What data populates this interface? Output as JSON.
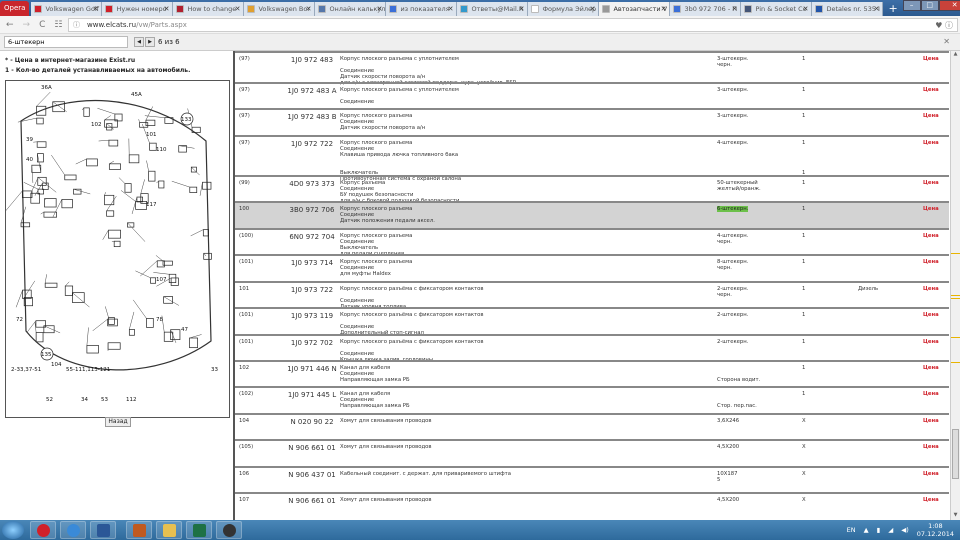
{
  "browser": {
    "name": "Opera",
    "tabs": [
      {
        "label": "Volkswagen Golf",
        "color": "#d0202a"
      },
      {
        "label": "Нужен номеро",
        "color": "#d0202a"
      },
      {
        "label": "How to change",
        "color": "#b02030"
      },
      {
        "label": "Volkswagen Bor",
        "color": "#e0a030"
      },
      {
        "label": "Онлайн калькул",
        "color": "#5577aa"
      },
      {
        "label": "из показателя",
        "color": "#3b6fd8"
      },
      {
        "label": "Ответы@Mail.R",
        "color": "#3399cc"
      },
      {
        "label": "Формула Эйлер",
        "color": "#ffffff"
      },
      {
        "label": "Автозапчасти V",
        "color": "#999999",
        "active": true
      },
      {
        "label": "3b0 972 706 - П",
        "color": "#3b6fd8"
      },
      {
        "label": "Pin & Socket Co",
        "color": "#445577"
      },
      {
        "label": "Detales nr. 535 I",
        "color": "#2255aa"
      }
    ],
    "url_domain": "www.elcats.ru",
    "url_path": "/vw/Parts.aspx"
  },
  "find": {
    "query": "6-штекерн",
    "count": "6 из 6"
  },
  "left": {
    "note1": "* - Цена в интернет-магазине Exist.ru",
    "note2": "1 - Кол-во деталей устанавливаемых на автомобиль.",
    "back": "Назад"
  },
  "rows": [
    {
      "ref": "(97)",
      "pn": "1J0 972 483",
      "desc": [
        "Корпус плоского разъема с уплотнителем",
        "",
        "Соединение",
        "Датчик скорости поворота а/н",
        "для а/н с электронной системой поддерж. курс. устойчив. ESP"
      ],
      "spec": [
        "3-штекерн.",
        "черн."
      ],
      "qty": [
        "1"
      ],
      "price": "Цена"
    },
    {
      "ref": "(97)",
      "pn": "1J0 972 483 A",
      "desc": [
        "Корпус плоского разъема с уплотнителем",
        "",
        "Соединение"
      ],
      "spec": [
        "3-штекерн."
      ],
      "qty": [
        "1"
      ],
      "price": "Цена"
    },
    {
      "ref": "(97)",
      "pn": "1J0 972 483 B",
      "desc": [
        "Корпус плоского разъема",
        "Соединение",
        "Датчик скорости поворота а/н"
      ],
      "spec": [
        "3-штекерн."
      ],
      "qty": [
        "1"
      ],
      "price": "Цена"
    },
    {
      "ref": "(97)",
      "pn": "1J0 972 722",
      "desc": [
        "Корпус плоского разъема",
        "Соединение",
        "Клавиша привода лючка топливного бака",
        "",
        "",
        "Выключатель",
        "Противоугонная система с охраной салона"
      ],
      "spec": [
        "4-штекерн."
      ],
      "qty": [
        "1",
        "",
        "",
        "",
        "",
        "1"
      ],
      "price": "Цена"
    },
    {
      "ref": "(99)",
      "pn": "4D0 973 373",
      "desc": [
        "Корпус разъема",
        "Соединение",
        "БУ подушек безопасности",
        "для а/н с боковой подушкой безопасности"
      ],
      "spec": [
        "50-штекерный",
        "желтый/оранж."
      ],
      "qty": [
        "1"
      ],
      "price": "Цена"
    },
    {
      "ref": "100",
      "pn": "3B0 972 706",
      "desc": [
        "Корпус плоского разъема",
        "Соединение",
        "Датчик положения педали аксел."
      ],
      "spec": [
        "6-штекерн."
      ],
      "qty": [
        "1"
      ],
      "price": "Цена",
      "highlight": true
    },
    {
      "ref": "(100)",
      "pn": "6N0 972 704",
      "desc": [
        "Корпус плоского разъема",
        "Соединение",
        "Выключатель",
        "для педали сцепления"
      ],
      "spec": [
        "4-штекерн.",
        "черн."
      ],
      "qty": [
        "1"
      ],
      "price": "Цена"
    },
    {
      "ref": "(101)",
      "pn": "1J0 973 714",
      "desc": [
        "Корпус плоского разъема",
        "Соединение",
        "для муфты Haldex"
      ],
      "spec": [
        "8-штекерн.",
        "черн."
      ],
      "qty": [
        "1"
      ],
      "price": "Цена"
    },
    {
      "ref": "101",
      "pn": "1J0 973 722",
      "desc": [
        "Корпус плоского разъёма с фиксатором контактов",
        "",
        "Соединение",
        "Датчик уровня топлива ."
      ],
      "spec": [
        "2-штекерн.",
        "черн."
      ],
      "qty": [
        "1"
      ],
      "note": "Дизель",
      "price": "Цена"
    },
    {
      "ref": "(101)",
      "pn": "1J0 973 119",
      "desc": [
        "Корпус плоского разъёма с фиксатором контактов",
        "",
        "Соединение",
        "Дополнительный стоп-сигнал"
      ],
      "spec": [
        "2-штекерн."
      ],
      "qty": [
        "1"
      ],
      "price": "Цена"
    },
    {
      "ref": "(101)",
      "pn": "1J0 972 702",
      "desc": [
        "Корпус плоского разъёма с фиксатором контактов",
        "",
        "Соединение",
        "Крышка лючка залив. горловины"
      ],
      "spec": [
        "2-штекерн."
      ],
      "qty": [
        "1"
      ],
      "price": "Цена"
    },
    {
      "ref": "102",
      "pn": "1J0 971 446 N",
      "desc": [
        "Канал для кабеля",
        "Соединение",
        "Направляющая замка РБ"
      ],
      "spec": [
        "",
        "",
        "Сторона водит."
      ],
      "qty": [
        "1"
      ],
      "price": "Цена"
    },
    {
      "ref": "(102)",
      "pn": "1J0 971 445 L",
      "desc": [
        "Канал для кабеля",
        "Соединение",
        "Направляющая замка РБ"
      ],
      "spec": [
        "",
        "",
        "Стор. пер.пас."
      ],
      "qty": [
        "1"
      ],
      "price": "Цена"
    },
    {
      "ref": "104",
      "pn": "N 020 90 22",
      "desc": [
        "Хомут для связывания проводов"
      ],
      "spec": [
        "3,6X246"
      ],
      "qty": [
        "X"
      ],
      "price": "Цена"
    },
    {
      "ref": "(105)",
      "pn": "N 906 661 01",
      "desc": [
        "Хомут для связывания проводов"
      ],
      "spec": [
        "4,5X200"
      ],
      "qty": [
        "X"
      ],
      "price": "Цена"
    },
    {
      "ref": "106",
      "pn": "N 906 437 01",
      "desc": [
        "Кабельный соединит. с держат. для приваривемого штифта"
      ],
      "spec": [
        "10X187",
        "5"
      ],
      "qty": [
        "X"
      ],
      "price": "Цена"
    },
    {
      "ref": "107",
      "pn": "N 906 661 01",
      "desc": [
        "Хомут для связывания проводов"
      ],
      "spec": [
        "4,5X200"
      ],
      "qty": [
        "X"
      ],
      "price": "Цена"
    }
  ],
  "taskbar": {
    "lang": "EN",
    "time": "1:08",
    "date": "07.12.2014"
  },
  "diagram_labels": [
    "36A",
    "45A",
    "133",
    "135",
    "107",
    "47",
    "52",
    "34",
    "53",
    "112",
    "33",
    "39",
    "40",
    "101",
    "110",
    "102",
    "104",
    "2-33,37-51",
    "55-111,113-121",
    "117",
    "78",
    "72"
  ]
}
